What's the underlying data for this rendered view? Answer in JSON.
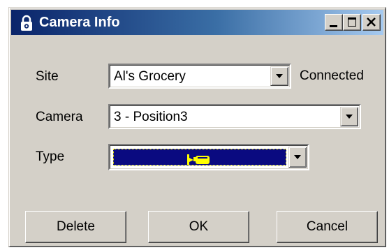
{
  "window": {
    "title": "Camera Info",
    "title_icon": "padlock-icon",
    "controls": [
      "minimize-icon",
      "maximize-icon",
      "close-icon"
    ]
  },
  "form": {
    "site": {
      "label": "Site",
      "value": "Al's Grocery",
      "status": "Connected"
    },
    "camera": {
      "label": "Camera",
      "value": "3 - Position3"
    },
    "type": {
      "label": "Type",
      "value_icon": "camera-icon"
    }
  },
  "buttons": {
    "delete": "Delete",
    "ok": "OK",
    "cancel": "Cancel"
  },
  "colors": {
    "title_start": "#0a246a",
    "title_end": "#a6caf0",
    "selection": "#0a0a80",
    "camera_icon": "#ffff00",
    "face": "#d4d0c8"
  }
}
